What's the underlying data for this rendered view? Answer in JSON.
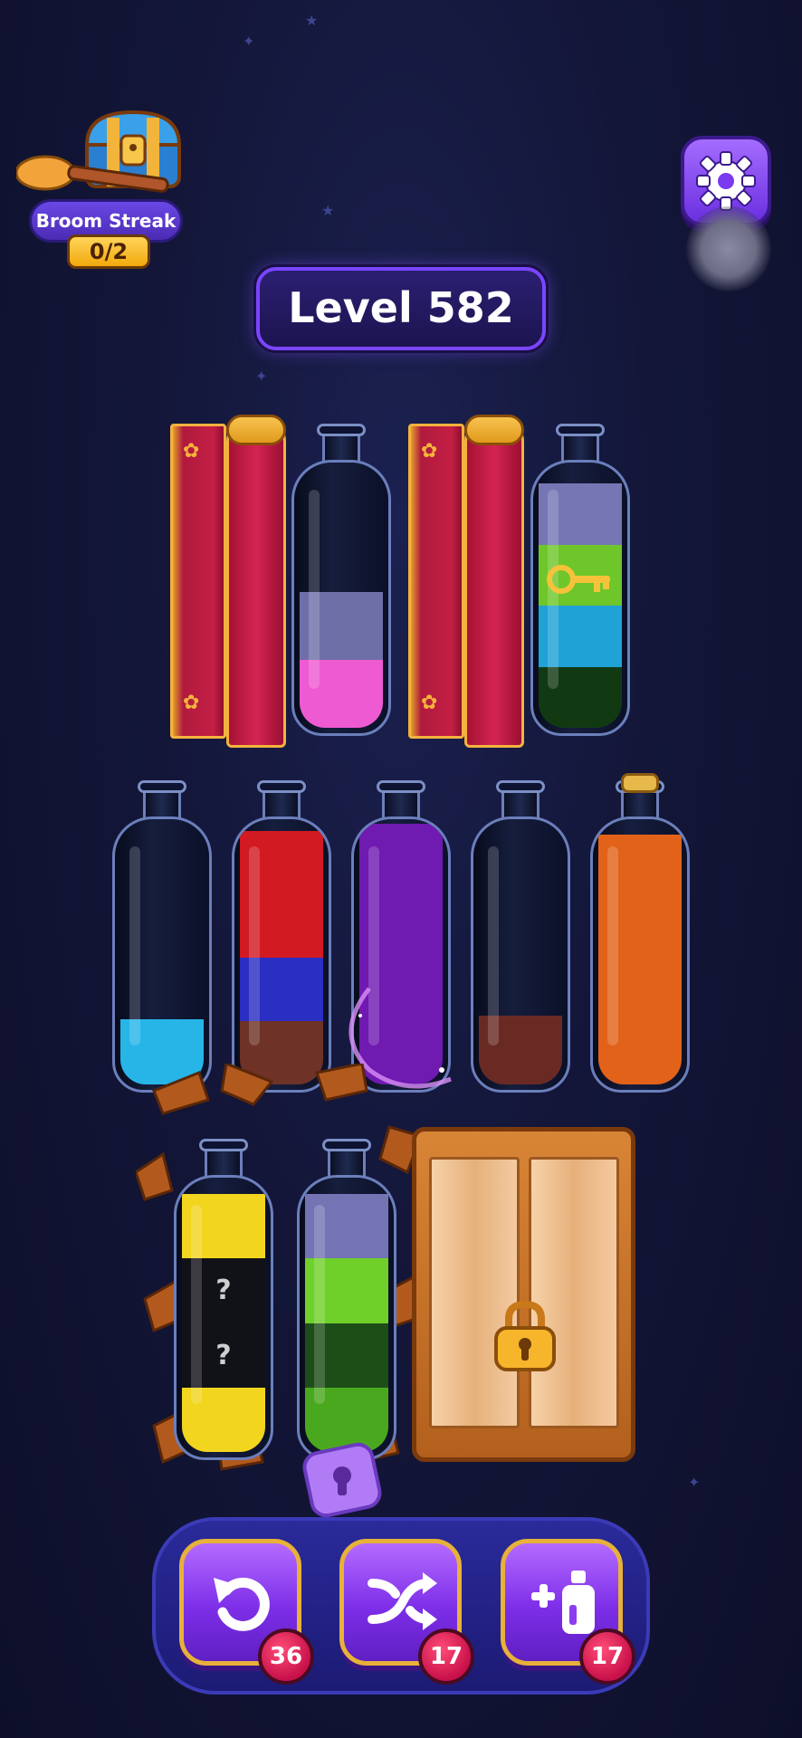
{
  "streak": {
    "label": "Broom Streak",
    "count": "0/2"
  },
  "level": {
    "label": "Level 582"
  },
  "bottles": {
    "row1": [
      {
        "id": "b2",
        "layers": [
          "#ee5ad2",
          "#6f6fa8"
        ]
      },
      {
        "id": "b4",
        "layers": [
          "#123a12",
          "#1fa2d6",
          "#6ec62a",
          "#7676b4"
        ]
      }
    ],
    "row2": [
      {
        "id": "b5",
        "layers": [
          "#27b5e8"
        ]
      },
      {
        "id": "b6",
        "layers": [
          "#6e3226",
          "#2a2ec2",
          "#d21a22",
          "#d21a22"
        ]
      },
      {
        "id": "b7",
        "layers": [
          "#6f1ab0",
          "#6f1ab0",
          "#6f1ab0",
          "#6f1ab0"
        ]
      },
      {
        "id": "b8",
        "layers": [
          "#6a2a24"
        ]
      },
      {
        "id": "b9",
        "layers": [
          "#e2621a",
          "#e2621a",
          "#e2621a",
          "#e2621a"
        ]
      }
    ],
    "row3": [
      {
        "id": "b10",
        "layers": [
          "#f2d51e",
          "#111118",
          "#111118",
          "#f2d51e"
        ],
        "unknown_mark": "?"
      },
      {
        "id": "b11",
        "layers": [
          "#4aa81e",
          "#1d4e18",
          "#6fd02a",
          "#7474b4"
        ]
      }
    ]
  },
  "toolbar": {
    "undo": {
      "icon": "undo-icon",
      "count": "36"
    },
    "shuffle": {
      "icon": "shuffle-icon",
      "count": "17"
    },
    "add_bottle": {
      "icon": "add-bottle-icon",
      "count": "17"
    }
  },
  "colors": {
    "accent": "#7a45ff",
    "gold": "#e7b13a",
    "badge": "#c8104a"
  }
}
